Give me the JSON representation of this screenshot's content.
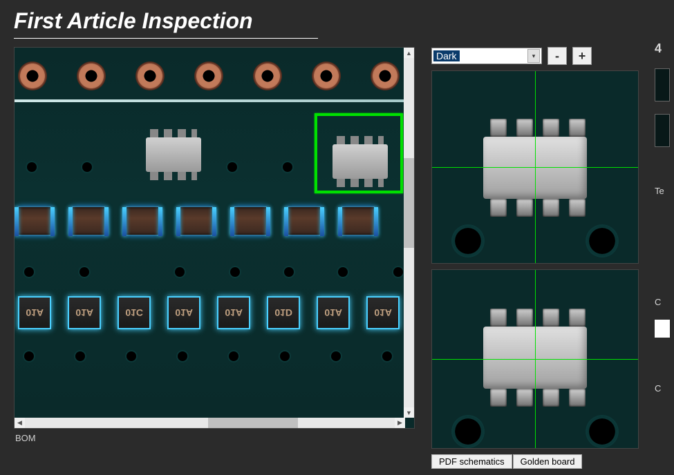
{
  "title": "First Article Inspection",
  "theme_select": {
    "selected": "Dark"
  },
  "zoom": {
    "minus": "-",
    "plus": "+"
  },
  "tabs": {
    "pdf": "PDF schematics",
    "golden": "Golden board"
  },
  "bom_label": "BOM",
  "far_right": {
    "top_num": "4",
    "label_te": "Te",
    "label_c1": "C",
    "label_c2": "C"
  },
  "resistor_labels": [
    "01A",
    "01A",
    "01C",
    "01A",
    "01A",
    "01D",
    "01A",
    "01A"
  ]
}
